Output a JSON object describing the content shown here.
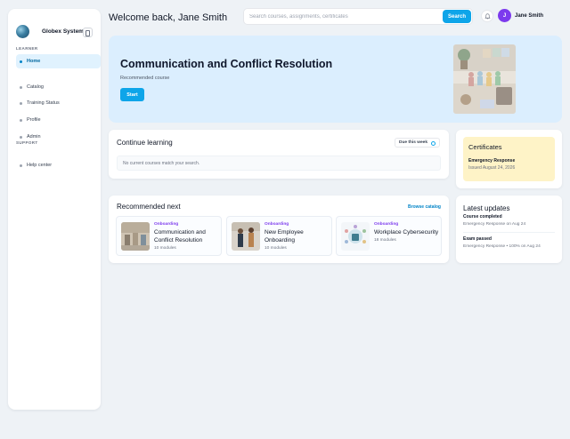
{
  "sidebar": {
    "brand": "Globex Systems",
    "sections": [
      {
        "label": "LEARNER",
        "items": [
          "Home",
          "Catalog",
          "Training Status",
          "Profile",
          "Admin"
        ]
      },
      {
        "label": "SUPPORT",
        "items": [
          "Help center"
        ]
      }
    ],
    "active_item": "Home"
  },
  "header": {
    "title": "Welcome back, Jane Smith",
    "search_placeholder": "Search courses, assignments, certificates",
    "search_button": "Search",
    "user_initial": "J",
    "user_name": "Jane Smith"
  },
  "hero": {
    "title": "Communication and Conflict Resolution",
    "subtitle": "Recommended course",
    "button": "Start"
  },
  "continue_learning": {
    "title": "Continue learning",
    "filter": "Due this week",
    "empty_message": "No current courses match your search."
  },
  "certificates": {
    "title": "Certificates",
    "items": [
      {
        "name": "Emergency Response",
        "date": "Issued August 24, 2026"
      }
    ]
  },
  "recommended": {
    "title": "Recommended next",
    "browse_link": "Browse catalog",
    "courses": [
      {
        "category": "Onboarding",
        "title": "Communication and Conflict Resolution",
        "modules": "10 modules"
      },
      {
        "category": "Onboarding",
        "title": "New Employee Onboarding",
        "modules": "10 modules"
      },
      {
        "category": "Onboarding",
        "title": "Workplace Cybersecurity",
        "modules": "18 modules"
      }
    ]
  },
  "updates": {
    "title": "Latest updates",
    "items": [
      {
        "heading": "Course completed",
        "detail": "Emergency Response on Aug 24"
      },
      {
        "heading": "Exam passed",
        "detail": "Emergency Response • 100% on Aug 24"
      }
    ]
  },
  "colors": {
    "accent": "#0ea5e9",
    "hero_bg": "#dbeefe",
    "certificate_bg": "#fef3c7",
    "category": "#7c3aed",
    "avatar": "#7c3aed"
  },
  "icons": [
    "globe-logo-icon",
    "sidebar-collapse-icon",
    "bell-icon",
    "target-icon"
  ]
}
